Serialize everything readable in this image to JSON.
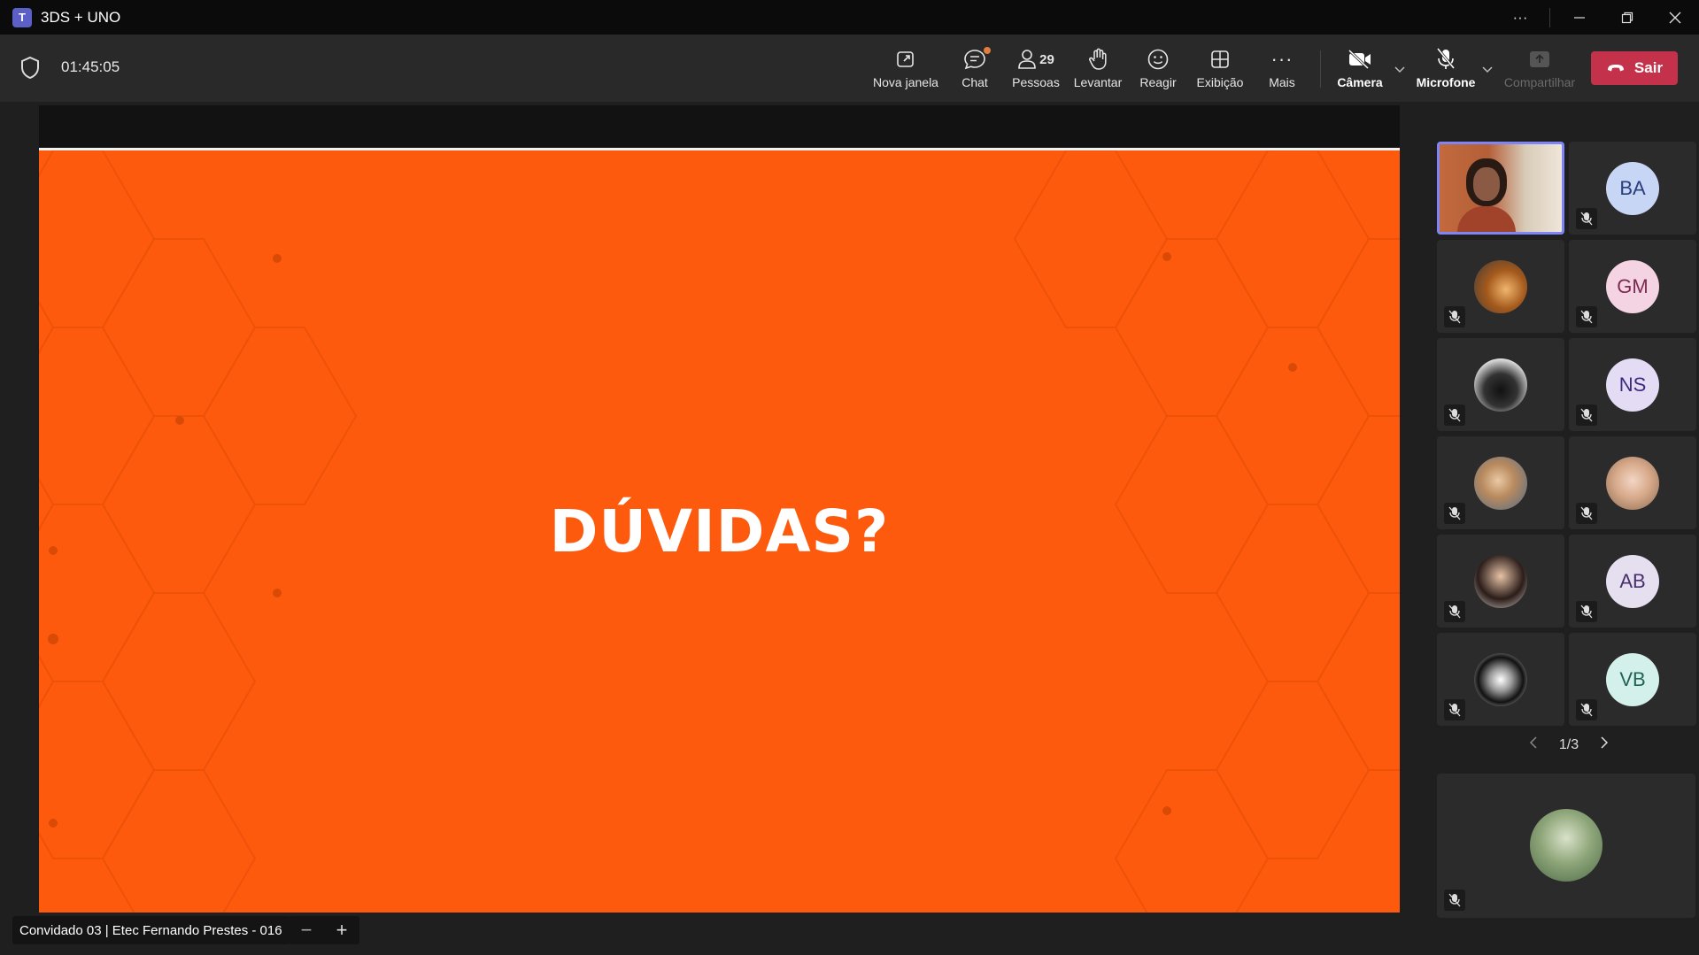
{
  "window": {
    "title": "3DS + UNO",
    "controls": [
      "more-options",
      "minimize",
      "restore",
      "close"
    ]
  },
  "toolbar": {
    "timer": "01:45:05",
    "tools": [
      {
        "id": "nova-janela",
        "label": "Nova janela",
        "icon": "popout-icon"
      },
      {
        "id": "chat",
        "label": "Chat",
        "icon": "chat-icon"
      },
      {
        "id": "pessoas",
        "label": "Pessoas",
        "icon": "people-icon",
        "count": "29"
      },
      {
        "id": "levantar",
        "label": "Levantar",
        "icon": "raise-hand-icon"
      },
      {
        "id": "reagir",
        "label": "Reagir",
        "icon": "react-icon"
      },
      {
        "id": "exibicao",
        "label": "Exibição",
        "icon": "view-icon"
      },
      {
        "id": "mais",
        "label": "Mais",
        "icon": "more-icon"
      },
      {
        "id": "camera",
        "label": "Câmera",
        "icon": "camera-off-icon"
      },
      {
        "id": "microfone",
        "label": "Microfone",
        "icon": "mic-off-icon"
      },
      {
        "id": "compartilhar",
        "label": "Compartilhar",
        "icon": "share-icon",
        "disabled": true
      }
    ],
    "leave_label": "Sair",
    "leave_color": "#c4314b"
  },
  "stage": {
    "slide_title": "DÚVIDAS?",
    "slide_color": "#fd5a0e",
    "presenter": "Convidado 03 | Etec Fernando Prestes - 016"
  },
  "gallery": {
    "participants": [
      {
        "type": "video",
        "active": true,
        "muted": false
      },
      {
        "type": "initials",
        "initials": "BA",
        "muted": true
      },
      {
        "type": "photo",
        "muted": true
      },
      {
        "type": "initials",
        "initials": "GM",
        "muted": true
      },
      {
        "type": "photo",
        "muted": true
      },
      {
        "type": "initials",
        "initials": "NS",
        "muted": true
      },
      {
        "type": "photo",
        "muted": true
      },
      {
        "type": "photo",
        "muted": true
      },
      {
        "type": "photo",
        "muted": true
      },
      {
        "type": "initials",
        "initials": "AB",
        "muted": true
      },
      {
        "type": "photo",
        "muted": true
      },
      {
        "type": "initials",
        "initials": "VB",
        "muted": true
      }
    ],
    "page": "1/3"
  }
}
